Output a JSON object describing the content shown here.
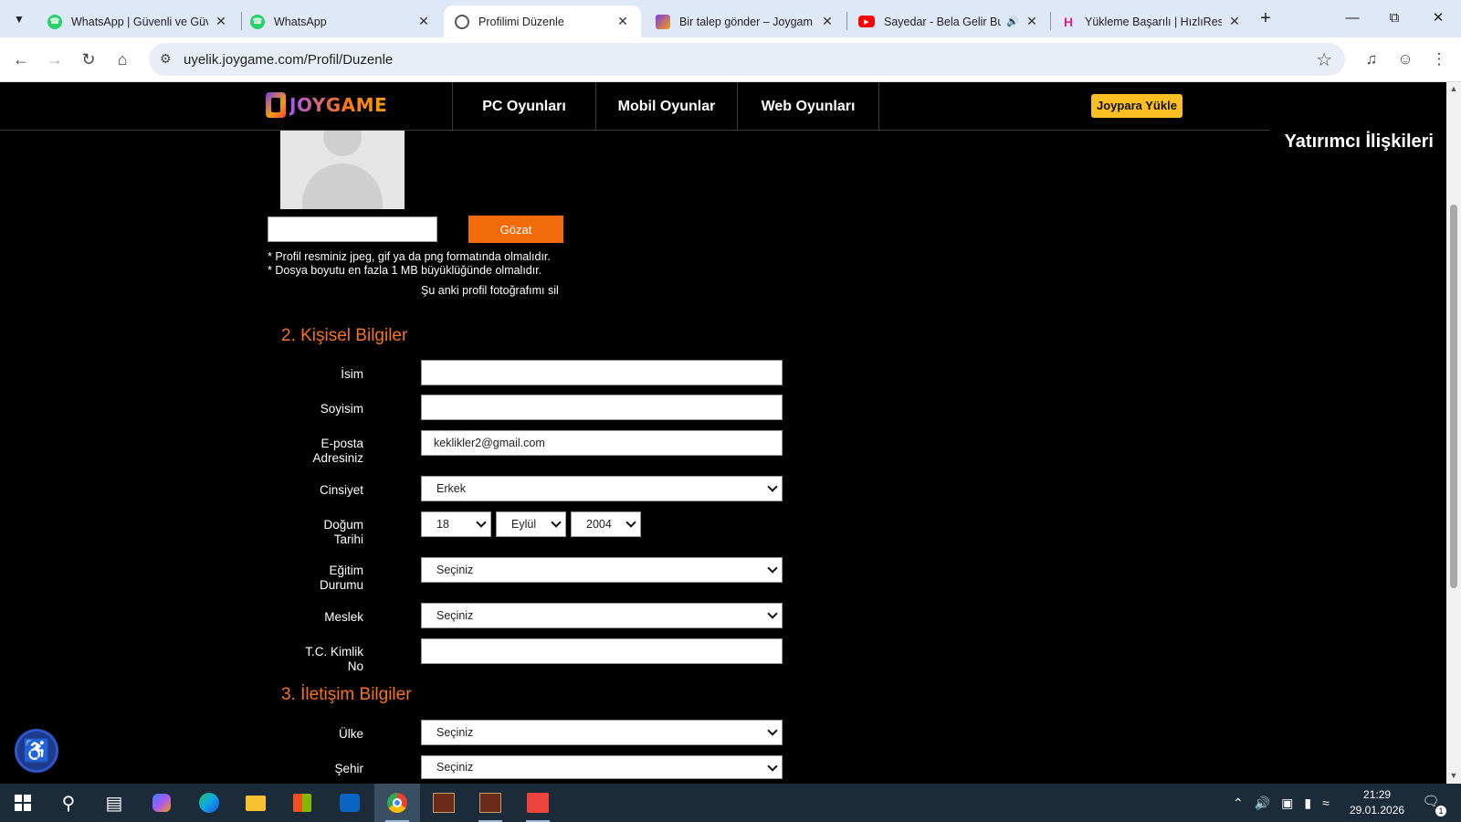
{
  "browser": {
    "tabs": [
      {
        "title": "WhatsApp | Güvenli ve Güv",
        "favicon": "whatsapp-icon"
      },
      {
        "title": "WhatsApp",
        "favicon": "whatsapp-icon"
      },
      {
        "title": "Profilimi Düzenle",
        "favicon": "globe-icon",
        "active": true
      },
      {
        "title": "Bir talep gönder – Joygam",
        "favicon": "joygame-icon"
      },
      {
        "title": "Sayedar - Bela Gelir Bu",
        "favicon": "youtube-icon",
        "audio": true
      },
      {
        "title": "Yükleme Başarılı | HızlıResi",
        "favicon": "hizliresim-icon"
      }
    ],
    "url": "uyelik.joygame.com/Profil/Duzenle"
  },
  "site": {
    "logo_text": "JOYGAME",
    "nav": [
      "PC Oyunları",
      "Mobil Oyunlar",
      "Web Oyunları"
    ],
    "joypara_label": "Joypara Yükle",
    "investor_label": "Yatırımcı İlişkileri"
  },
  "photo": {
    "browse_label": "Gözat",
    "hint1": "* Profil resminiz jpeg, gif ya da png formatında olmalıdır.",
    "hint2": "* Dosya boyutu en fazla 1 MB büyüklüğünde olmalıdır.",
    "delete_label": "Şu anki profil fotoğrafımı sil"
  },
  "personal": {
    "title": "2. Kişisel Bilgiler",
    "name_label": "İsim",
    "name_value": "",
    "surname_label": "Soyisim",
    "surname_value": "",
    "email_label_1": "E-posta",
    "email_label_2": "Adresiniz",
    "email_value": "keklikler2@gmail.com",
    "gender_label": "Cinsiyet",
    "gender_value": "Erkek",
    "birth_label_1": "Doğum",
    "birth_label_2": "Tarihi",
    "birth_day": "18",
    "birth_month": "Eylül",
    "birth_year": "2004",
    "education_label_1": "Eğitim",
    "education_label_2": "Durumu",
    "education_value": "Seçiniz",
    "job_label": "Meslek",
    "job_value": "Seçiniz",
    "tc_label_1": "T.C. Kimlik",
    "tc_label_2": "No",
    "tc_value": ""
  },
  "contact": {
    "title": "3. İletişim Bilgiler",
    "country_label": "Ülke",
    "country_value": "Seçiniz",
    "city_label": "Şehir",
    "city_value": "Seçiniz"
  },
  "taskbar": {
    "time": "21:29",
    "date": "29.01.2026",
    "notification_count": "1"
  },
  "colors": {
    "accent_orange": "#f26b0b",
    "section_title": "#f7731c",
    "joypara_yellow": "#fbbf24"
  }
}
